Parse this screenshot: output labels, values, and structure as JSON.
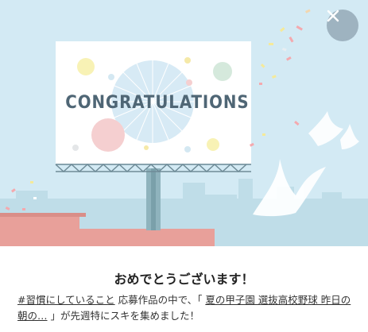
{
  "banner": {
    "billboard_text": "CONGRATULATIONS"
  },
  "close_icon": "close-icon",
  "dialog": {
    "title": "おめでとうございます！",
    "hashtag_link": "#習慣にしていること",
    "text_1": " 応募作品の中で、「 ",
    "article_link": "夏の甲子園 選抜高校野球 昨日の朝の…",
    "text_2": " 」が先週特にスキを集めました！"
  },
  "colors": {
    "sky": "#d3eaf4",
    "building": "#bfdde8",
    "roof": "#e8a09a",
    "billboard_frame": "#6f8b97",
    "text": "#4f6675"
  }
}
